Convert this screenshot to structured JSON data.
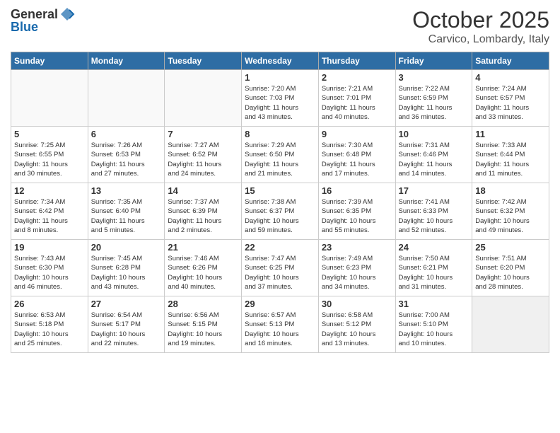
{
  "header": {
    "logo_line1": "General",
    "logo_line2": "Blue",
    "title": "October 2025",
    "subtitle": "Carvico, Lombardy, Italy"
  },
  "weekdays": [
    "Sunday",
    "Monday",
    "Tuesday",
    "Wednesday",
    "Thursday",
    "Friday",
    "Saturday"
  ],
  "weeks": [
    [
      {
        "day": "",
        "info": ""
      },
      {
        "day": "",
        "info": ""
      },
      {
        "day": "",
        "info": ""
      },
      {
        "day": "1",
        "info": "Sunrise: 7:20 AM\nSunset: 7:03 PM\nDaylight: 11 hours\nand 43 minutes."
      },
      {
        "day": "2",
        "info": "Sunrise: 7:21 AM\nSunset: 7:01 PM\nDaylight: 11 hours\nand 40 minutes."
      },
      {
        "day": "3",
        "info": "Sunrise: 7:22 AM\nSunset: 6:59 PM\nDaylight: 11 hours\nand 36 minutes."
      },
      {
        "day": "4",
        "info": "Sunrise: 7:24 AM\nSunset: 6:57 PM\nDaylight: 11 hours\nand 33 minutes."
      }
    ],
    [
      {
        "day": "5",
        "info": "Sunrise: 7:25 AM\nSunset: 6:55 PM\nDaylight: 11 hours\nand 30 minutes."
      },
      {
        "day": "6",
        "info": "Sunrise: 7:26 AM\nSunset: 6:53 PM\nDaylight: 11 hours\nand 27 minutes."
      },
      {
        "day": "7",
        "info": "Sunrise: 7:27 AM\nSunset: 6:52 PM\nDaylight: 11 hours\nand 24 minutes."
      },
      {
        "day": "8",
        "info": "Sunrise: 7:29 AM\nSunset: 6:50 PM\nDaylight: 11 hours\nand 21 minutes."
      },
      {
        "day": "9",
        "info": "Sunrise: 7:30 AM\nSunset: 6:48 PM\nDaylight: 11 hours\nand 17 minutes."
      },
      {
        "day": "10",
        "info": "Sunrise: 7:31 AM\nSunset: 6:46 PM\nDaylight: 11 hours\nand 14 minutes."
      },
      {
        "day": "11",
        "info": "Sunrise: 7:33 AM\nSunset: 6:44 PM\nDaylight: 11 hours\nand 11 minutes."
      }
    ],
    [
      {
        "day": "12",
        "info": "Sunrise: 7:34 AM\nSunset: 6:42 PM\nDaylight: 11 hours\nand 8 minutes."
      },
      {
        "day": "13",
        "info": "Sunrise: 7:35 AM\nSunset: 6:40 PM\nDaylight: 11 hours\nand 5 minutes."
      },
      {
        "day": "14",
        "info": "Sunrise: 7:37 AM\nSunset: 6:39 PM\nDaylight: 11 hours\nand 2 minutes."
      },
      {
        "day": "15",
        "info": "Sunrise: 7:38 AM\nSunset: 6:37 PM\nDaylight: 10 hours\nand 59 minutes."
      },
      {
        "day": "16",
        "info": "Sunrise: 7:39 AM\nSunset: 6:35 PM\nDaylight: 10 hours\nand 55 minutes."
      },
      {
        "day": "17",
        "info": "Sunrise: 7:41 AM\nSunset: 6:33 PM\nDaylight: 10 hours\nand 52 minutes."
      },
      {
        "day": "18",
        "info": "Sunrise: 7:42 AM\nSunset: 6:32 PM\nDaylight: 10 hours\nand 49 minutes."
      }
    ],
    [
      {
        "day": "19",
        "info": "Sunrise: 7:43 AM\nSunset: 6:30 PM\nDaylight: 10 hours\nand 46 minutes."
      },
      {
        "day": "20",
        "info": "Sunrise: 7:45 AM\nSunset: 6:28 PM\nDaylight: 10 hours\nand 43 minutes."
      },
      {
        "day": "21",
        "info": "Sunrise: 7:46 AM\nSunset: 6:26 PM\nDaylight: 10 hours\nand 40 minutes."
      },
      {
        "day": "22",
        "info": "Sunrise: 7:47 AM\nSunset: 6:25 PM\nDaylight: 10 hours\nand 37 minutes."
      },
      {
        "day": "23",
        "info": "Sunrise: 7:49 AM\nSunset: 6:23 PM\nDaylight: 10 hours\nand 34 minutes."
      },
      {
        "day": "24",
        "info": "Sunrise: 7:50 AM\nSunset: 6:21 PM\nDaylight: 10 hours\nand 31 minutes."
      },
      {
        "day": "25",
        "info": "Sunrise: 7:51 AM\nSunset: 6:20 PM\nDaylight: 10 hours\nand 28 minutes."
      }
    ],
    [
      {
        "day": "26",
        "info": "Sunrise: 6:53 AM\nSunset: 5:18 PM\nDaylight: 10 hours\nand 25 minutes."
      },
      {
        "day": "27",
        "info": "Sunrise: 6:54 AM\nSunset: 5:17 PM\nDaylight: 10 hours\nand 22 minutes."
      },
      {
        "day": "28",
        "info": "Sunrise: 6:56 AM\nSunset: 5:15 PM\nDaylight: 10 hours\nand 19 minutes."
      },
      {
        "day": "29",
        "info": "Sunrise: 6:57 AM\nSunset: 5:13 PM\nDaylight: 10 hours\nand 16 minutes."
      },
      {
        "day": "30",
        "info": "Sunrise: 6:58 AM\nSunset: 5:12 PM\nDaylight: 10 hours\nand 13 minutes."
      },
      {
        "day": "31",
        "info": "Sunrise: 7:00 AM\nSunset: 5:10 PM\nDaylight: 10 hours\nand 10 minutes."
      },
      {
        "day": "",
        "info": ""
      }
    ]
  ]
}
